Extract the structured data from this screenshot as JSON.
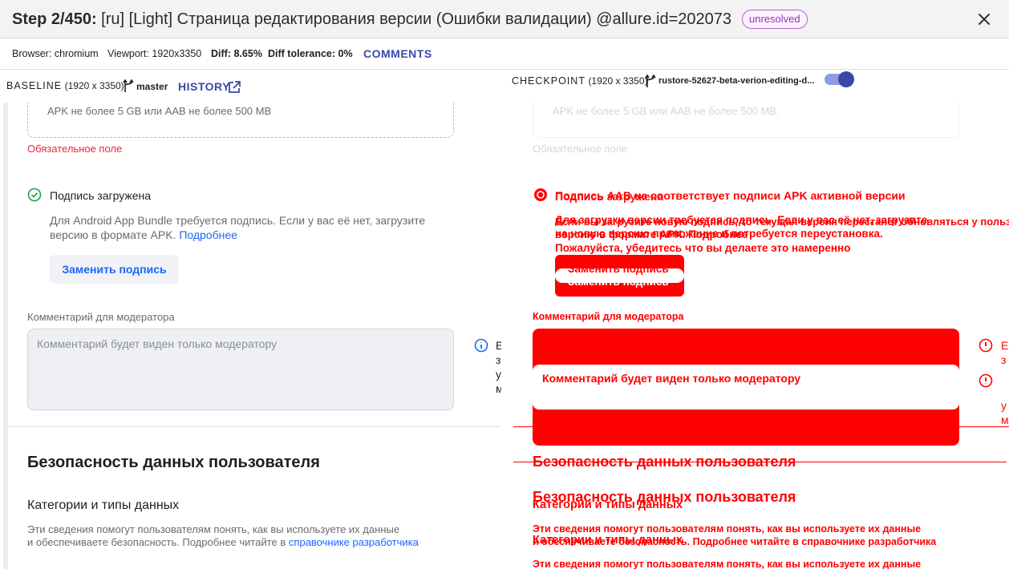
{
  "header": {
    "step": "Step 2/450:",
    "title": "[ru] [Light] Страница редактирования версии (Ошибки валидации) @allure.id=202073",
    "status": "unresolved"
  },
  "info": {
    "browser_label": "Browser:",
    "browser": "chromium",
    "viewport_label": "Viewport:",
    "viewport": "1920x3350",
    "diff_label": "Diff:",
    "diff": "8.65%",
    "tolerance_label": "Diff tolerance:",
    "tolerance": "0%",
    "comments": "COMMENTS"
  },
  "baseline": {
    "label": "BASELINE",
    "size": "(1920 x 3350)",
    "branch": "master",
    "history": "HISTORY"
  },
  "checkpoint": {
    "label": "CHECKPOINT",
    "size": "(1920 x 3350)",
    "branch": "rustore-52627-beta-verion-editing-d..."
  },
  "left": {
    "upload_hint": "APK не более 5 GB или AAB не более 500 MB",
    "required_error": "Обязательное поле",
    "signature_status": "Подпись загружена",
    "signature_desc_1": "Для Android App Bundle требуется подпись. Если у вас её нет, загрузите",
    "signature_desc_2": "версию в формате APK.",
    "more_link": "Подробнее",
    "replace_button": "Заменить подпись",
    "comment_label": "Комментарий для модератора",
    "comment_placeholder": "Комментарий будет виден только модератору",
    "side_glyphs": [
      "Е",
      "з",
      "у",
      "м"
    ],
    "section_title": "Безопасность данных пользователя",
    "subsection_title": "Категории и типы данных",
    "desc_1": "Эти сведения помогут пользователям понять, как вы используете их данные",
    "desc_2": "и обеспечиваете безопасность. Подробнее читайте в",
    "guide_link": "справочнике разработчика"
  },
  "right": {
    "upload_hint": "APK не более 5 GB или AAB не более 500 MB.",
    "required_error": "Обязательное поле",
    "overlap_a": "Подпись AAB не соответствует подписи APK активной версии",
    "overlap_a2": "Подпись загружена",
    "warning_1": "Для загрузки версии требуется подпись. Если у вас её нет, загрузите",
    "warning_1b": "версию в формате APK. Подробнее",
    "warning_2": "Если вы загрузите новую подпись, то текущая версия перестанет обновляться у пользователей,",
    "warning_3": "на новую версию приложение и потребуется переустановка.",
    "warning_4": "Пожалуйста, убедитесь что вы делаете это намеренно",
    "replace_button": "Заменить подпись",
    "comment_label": "Комментарий для модератора",
    "comment_placeholder": "Комментарий будет виден только модератору",
    "side_glyphs": [
      "Е",
      "з",
      "у",
      "м"
    ],
    "section_title": "Безопасность данных пользователя",
    "subsection_title": "Категории и типы данных",
    "desc_1": "Эти сведения помогут пользователям понять, как вы используете их данные",
    "desc_2": "и обеспечиваете безопасность. Подробнее читайте в справочнике разработчика"
  },
  "colors": {
    "accent": "#3949ab",
    "diff": "#ff0000",
    "error": "#e5283a",
    "link": "#1a66ff",
    "success": "#1e9e4a",
    "badge": "#b55ed8"
  }
}
